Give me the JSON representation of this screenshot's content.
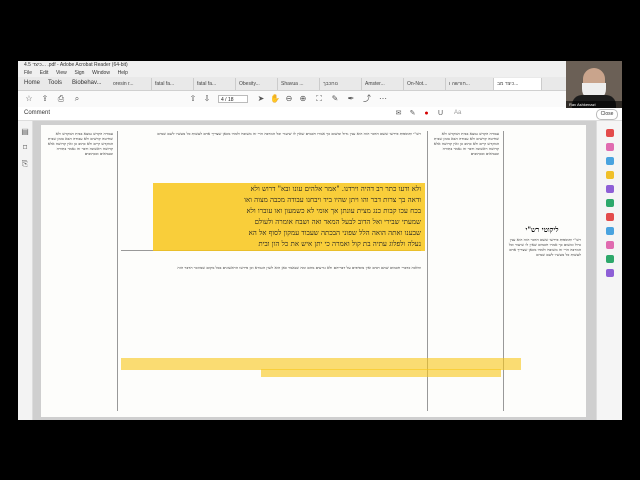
{
  "window": {
    "title": "4.5 כיצד... .pdf - Adobe Acrobat Reader (64-bit)"
  },
  "menu": [
    "File",
    "Edit",
    "View",
    "Sign",
    "Window",
    "Help"
  ],
  "nav_tabs": [
    "Home",
    "Tools",
    "Biobehav..."
  ],
  "doc_tabs": [
    "oresin r...",
    "fatal fa...",
    "fatal fa...",
    "Obesity...",
    "Shavua ...",
    "נוחכבך",
    "Amster...",
    "On-Not...",
    "חורשה ו...",
    "כיצד מב..."
  ],
  "toolbar": {
    "page_value": "4",
    "page_total": "/ 18"
  },
  "comment_bar": {
    "label": "Comment",
    "close_label": "Close",
    "text_tool": "Aa"
  },
  "video": {
    "caption": "Rav Ashkenazi"
  },
  "document": {
    "section_heading": "ליקוטי רש\"י",
    "highlight_lines": [
      "ולא ודעו כתר רב דהיה וירדנו. \"אמר אלהים עונו ובא\" דרוש ולא",
      "ודאה בך צרות דבר והו ויתן שהיו ביד ויבחנו עבודה מכבה מצוה ואו",
      "בכח עכו קבות כנג מצית עונתן אך אומי לא כשמעון ואו עוברו ולא",
      "שמעתי שבירי ואל הדוב לבעל המאד ואה ושבח אומרה ולעולם",
      "שבענו ואתה הואה הלל שפוני הבכתה שעבוד עמקון לסוף אל הא",
      "נעלה ולפלוג עתיה בת קול ואמרה כי יתן איש את כל הון ובית"
    ],
    "body_columns": [
      "עבודה הקדש נמצא בבית המקדש ולא שחיטה קדשים ולא עבודה הבא בזמן שבית המקדש קיים ולא כתוב כן ואין קדושה אלא קדושה ראשונה ודבר זה נאמר בתורה ובנביאים ובכתובים",
      "רש\"י ותוספות פירשו ששם הדבר הזה הוא ענין גדול ומשום כך אמרו חכמים שאין לו שיעור וכל המרבה הרי זה משובח ולמדו מכאן שצריך אדם לעשות כל מעשיו לשם שמים",
      "והלכה כדברי חכמים שהם רבים ואין מוסיפים על דבריהם ולא גורעים מהם ומה שנאמר כאן הוא לשון הגמרא וכן פירשו הראשונים בכל מקום שמוזכר הדבר הזה"
    ]
  }
}
